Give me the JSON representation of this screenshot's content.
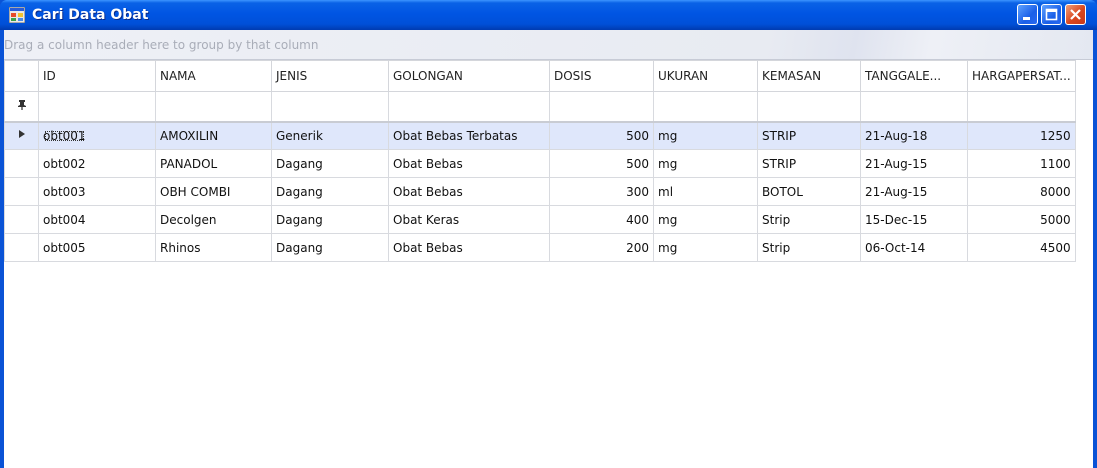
{
  "window": {
    "title": "Cari Data Obat",
    "controls": {
      "minimize": "minimize-icon",
      "maximize": "maximize-icon",
      "close": "close-icon"
    }
  },
  "group_panel": {
    "hint": "Drag a column header here to group by that column"
  },
  "grid": {
    "columns": [
      "ID",
      "NAMA",
      "JENIS",
      "GOLONGAN",
      "DOSIS",
      "UKURAN",
      "KEMASAN",
      "TANGGALE...",
      "HARGAPERSAT..."
    ],
    "filter_icon": "pin-icon",
    "current_row_icon": "row-pointer-icon",
    "rows": [
      {
        "id": "obt001",
        "nama": "AMOXILIN",
        "jenis": "Generik",
        "golongan": "Obat Bebas Terbatas",
        "dosis": "500",
        "ukuran": "mg",
        "kemasan": "STRIP",
        "tanggal": "21-Aug-18",
        "harga": "1250"
      },
      {
        "id": "obt002",
        "nama": "PANADOL",
        "jenis": "Dagang",
        "golongan": "Obat Bebas",
        "dosis": "500",
        "ukuran": "mg",
        "kemasan": "STRIP",
        "tanggal": "21-Aug-15",
        "harga": "1100"
      },
      {
        "id": "obt003",
        "nama": "OBH COMBI",
        "jenis": "Dagang",
        "golongan": "Obat Bebas",
        "dosis": "300",
        "ukuran": "ml",
        "kemasan": "BOTOL",
        "tanggal": "21-Aug-15",
        "harga": "8000"
      },
      {
        "id": "obt004",
        "nama": "Decolgen",
        "jenis": "Dagang",
        "golongan": "Obat Keras",
        "dosis": "400",
        "ukuran": "mg",
        "kemasan": "Strip",
        "tanggal": "15-Dec-15",
        "harga": "5000"
      },
      {
        "id": "obt005",
        "nama": "Rhinos",
        "jenis": "Dagang",
        "golongan": "Obat Bebas",
        "dosis": "200",
        "ukuran": "mg",
        "kemasan": "Strip",
        "tanggal": "06-Oct-14",
        "harga": "4500"
      }
    ]
  }
}
